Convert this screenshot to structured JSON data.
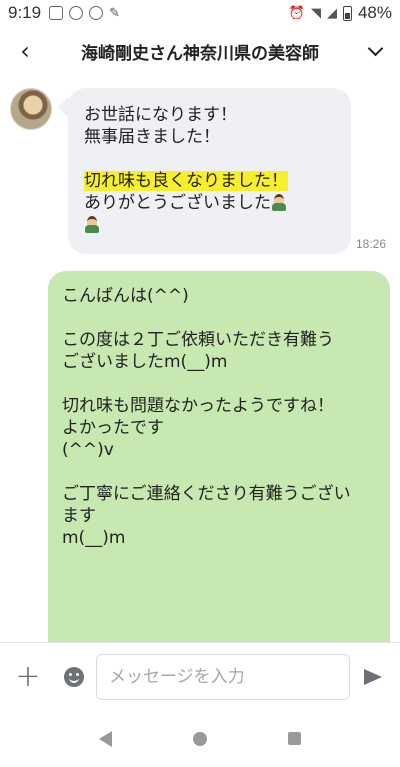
{
  "status_bar": {
    "time": "9:19",
    "battery": "48%",
    "icons": [
      "news-icon",
      "instagram-icon",
      "link-icon",
      "pin-icon",
      "alarm-icon",
      "wifi-icon",
      "signal-icon",
      "battery-icon"
    ]
  },
  "header": {
    "title": "海崎剛史さん神奈川県の美容師"
  },
  "messages": {
    "incoming": {
      "line1": "お世話になります！",
      "line2": "無事届きました！",
      "line3": "切れ味も良くなりました！",
      "line4": "ありがとうございました",
      "time": "18:26"
    },
    "outgoing": {
      "line1": "こんばんは(^^)",
      "line2": "この度は２丁ご依頼いただき有難う",
      "line3": "ございましたm(__)m",
      "line4": "切れ味も問題なかったようですね！",
      "line5": "よかったです",
      "line6": "(^^)v",
      "line7": "ご丁寧にご連絡くださり有難うござい",
      "line8": "ます",
      "line9": "m(__)m"
    }
  },
  "input_bar": {
    "placeholder": "メッセージを入力"
  },
  "colors": {
    "incoming_bubble": "#eef0f4",
    "outgoing_bubble": "#c7e8b0",
    "highlight": "#f8ef2b"
  }
}
